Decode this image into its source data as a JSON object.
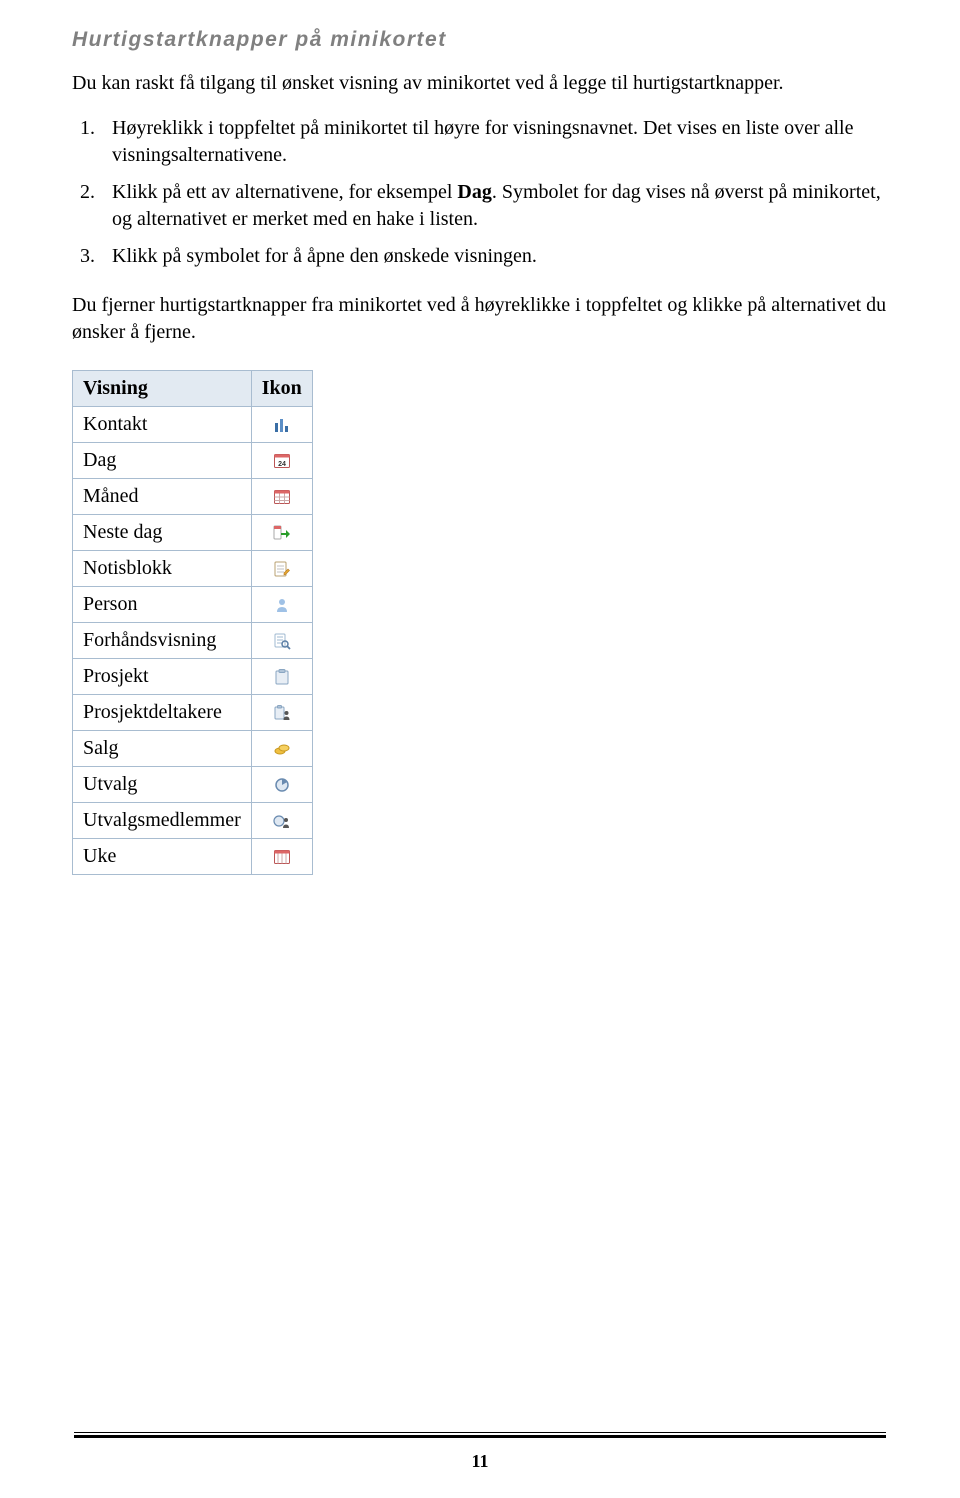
{
  "heading": "Hurtigstartknapper på minikortet",
  "intro": "Du kan raskt få tilgang til ønsket visning av minikortet ved å legge til hurtigstartknapper.",
  "steps": [
    "Høyreklikk i toppfeltet på minikortet til høyre for visningsnavnet. Det vises en liste over alle visningsalternativene.",
    "Klikk på ett av alternativene, for eksempel <b>Dag</b>. Symbolet for dag vises nå øverst på minikortet, og alternativet er merket med en hake i listen.",
    "Klikk på symbolet for å åpne den ønskede visningen."
  ],
  "after_list": "Du fjerner hurtigstartknapper fra minikortet ved å høyreklikke i toppfeltet og klikke på alternativet du ønsker å fjerne.",
  "table": {
    "header_visning": "Visning",
    "header_ikon": "Ikon",
    "rows": [
      {
        "label": "Kontakt",
        "icon": "kontakt"
      },
      {
        "label": "Dag",
        "icon": "dag"
      },
      {
        "label": "Måned",
        "icon": "maned"
      },
      {
        "label": "Neste dag",
        "icon": "neste-dag"
      },
      {
        "label": "Notisblokk",
        "icon": "notisblokk"
      },
      {
        "label": "Person",
        "icon": "person"
      },
      {
        "label": "Forhåndsvisning",
        "icon": "forhandsvisning"
      },
      {
        "label": "Prosjekt",
        "icon": "prosjekt"
      },
      {
        "label": "Prosjektdeltakere",
        "icon": "prosjektdeltakere"
      },
      {
        "label": "Salg",
        "icon": "salg"
      },
      {
        "label": "Utvalg",
        "icon": "utvalg"
      },
      {
        "label": "Utvalgsmedlemmer",
        "icon": "utvalgsmedlemmer"
      },
      {
        "label": "Uke",
        "icon": "uke"
      }
    ]
  },
  "page_number": "11"
}
